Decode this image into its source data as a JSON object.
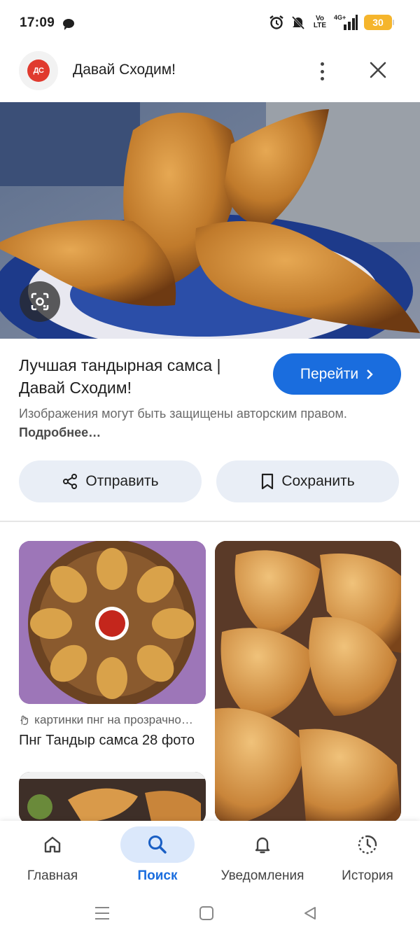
{
  "status_bar": {
    "time": "17:09",
    "volte": "Vo\nLTE",
    "network": "4G+",
    "battery": "30",
    "battery_color": "#f5b52c"
  },
  "header": {
    "logo_text": "ДС",
    "site_name": "Давай Сходим!",
    "logo_color": "#e03a2e"
  },
  "result": {
    "title": "Лучшая тандырная самса | Давай Сходим!",
    "visit_label": "Перейти",
    "copyright_text": "Изображения могут быть защищены авторским правом.",
    "more_link": "Подробнее…",
    "share_label": "Отправить",
    "save_label": "Сохранить",
    "accent": "#1a6dde"
  },
  "related": [
    {
      "source": "картинки пнг на прозрачном фоне",
      "title": "Пнг Тандыр самса 28 фото"
    }
  ],
  "bottom_nav": {
    "home": "Главная",
    "search": "Поиск",
    "notifications": "Уведомления",
    "history": "История"
  },
  "icons": {
    "more": "more-vert-icon",
    "close": "close-icon",
    "lens": "google-lens-icon",
    "share": "share-icon",
    "bookmark": "bookmark-icon",
    "home": "home-icon",
    "search": "search-icon",
    "bell": "bell-icon",
    "history": "history-icon"
  }
}
